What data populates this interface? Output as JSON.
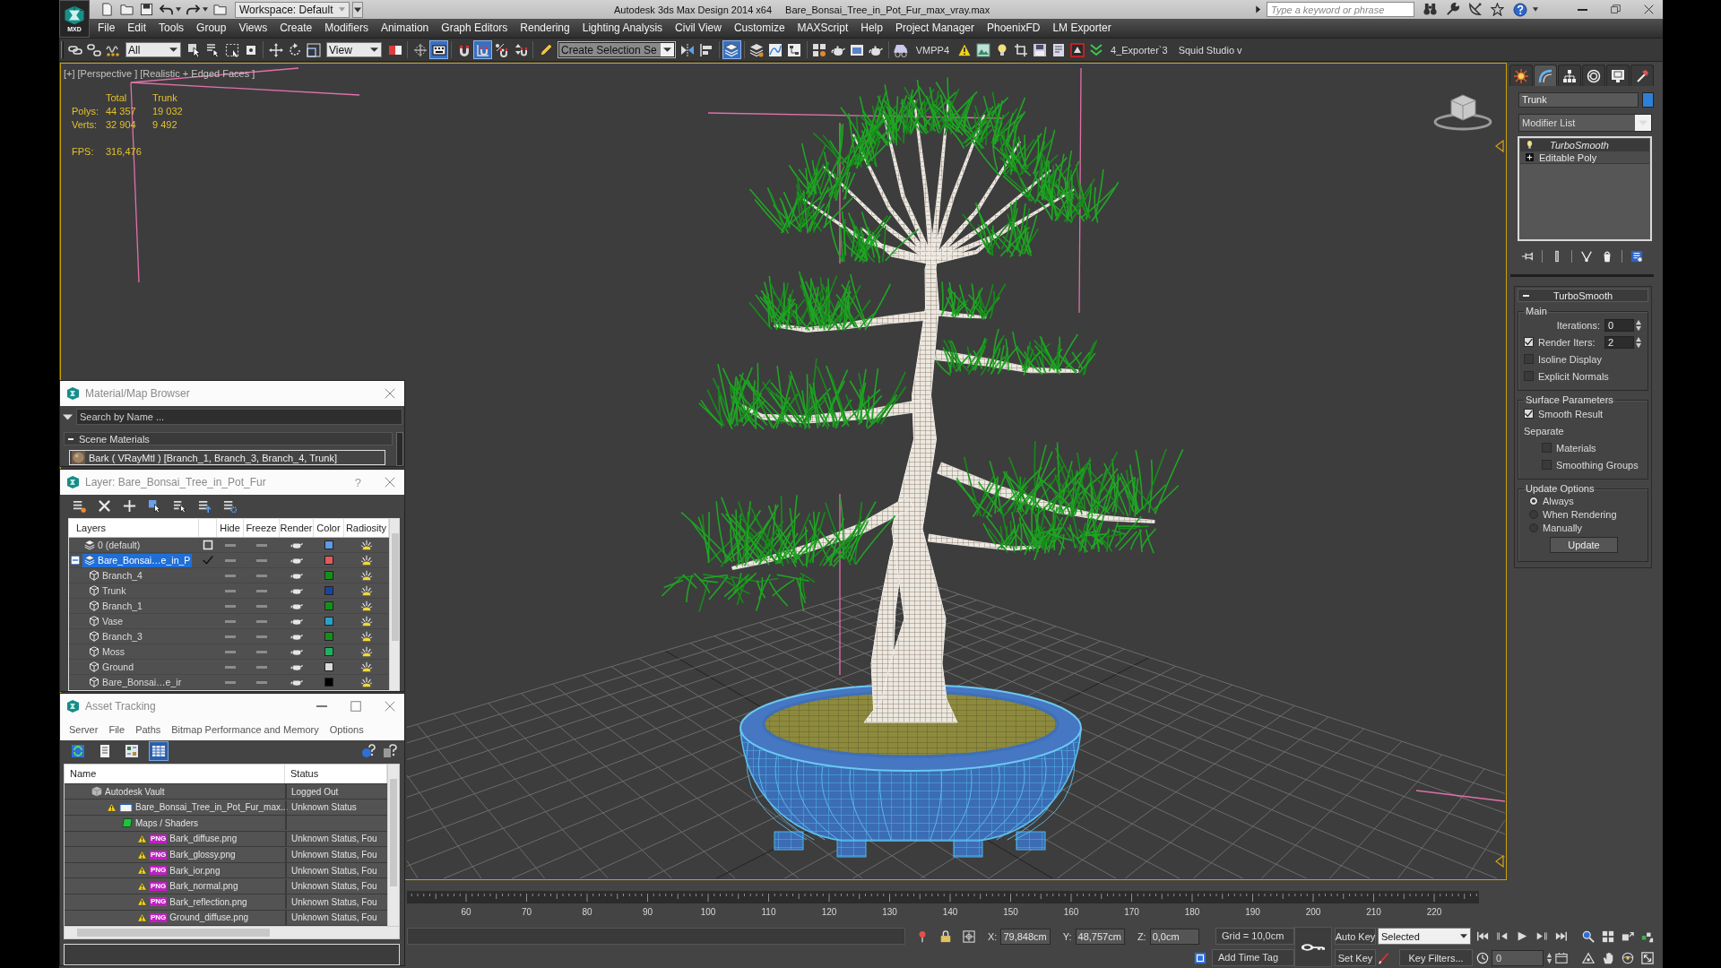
{
  "title_bar": {
    "logo_label": "MXD",
    "workspace": "Workspace: Default",
    "app_name": "Autodesk 3ds Max Design 2014 x64",
    "file_name": "Bare_Bonsai_Tree_in_Pot_Fur_max_vray.max",
    "search": {
      "placeholder": "Type a keyword or phrase"
    }
  },
  "menu": [
    "File",
    "Edit",
    "Tools",
    "Group",
    "Views",
    "Create",
    "Modifiers",
    "Animation",
    "Graph Editors",
    "Rendering",
    "Lighting Analysis",
    "Civil View",
    "Customize",
    "MAXScript",
    "Help",
    "Project Manager",
    "PhoenixFD",
    "LM Exporter"
  ],
  "toolbar": [
    {
      "kind": "button",
      "on": false
    },
    {
      "kind": "button",
      "on": false
    },
    {
      "kind": "button",
      "on": false
    },
    {
      "kind": "dropdown",
      "value": "All"
    },
    {
      "kind": "button",
      "on": false
    },
    {
      "kind": "button",
      "on": false
    },
    {
      "kind": "button",
      "on": false
    },
    {
      "kind": "button",
      "on": false
    },
    {
      "kind": "separator"
    },
    {
      "kind": "button",
      "on": false
    },
    {
      "kind": "button",
      "on": false
    },
    {
      "kind": "button",
      "on": false
    },
    {
      "kind": "dropdown",
      "value": "View"
    },
    {
      "kind": "button",
      "on": false
    },
    {
      "kind": "separator"
    },
    {
      "kind": "button",
      "on": false
    },
    {
      "kind": "button",
      "on": true
    },
    {
      "kind": "separator"
    },
    {
      "kind": "button",
      "on": false
    },
    {
      "kind": "button",
      "on": true
    },
    {
      "kind": "button",
      "on": false
    },
    {
      "kind": "button",
      "on": false
    },
    {
      "kind": "separator"
    },
    {
      "kind": "button",
      "on": false
    },
    {
      "kind": "combo",
      "value": "Create Selection Se"
    },
    {
      "kind": "button",
      "on": false
    },
    {
      "kind": "button",
      "on": false
    },
    {
      "kind": "separator"
    },
    {
      "kind": "button",
      "on": true
    },
    {
      "kind": "separator"
    },
    {
      "kind": "button",
      "on": false
    },
    {
      "kind": "button",
      "on": false
    },
    {
      "kind": "button",
      "on": false
    },
    {
      "kind": "separator"
    },
    {
      "kind": "button",
      "on": false
    },
    {
      "kind": "button",
      "on": false
    },
    {
      "kind": "button",
      "on": false
    },
    {
      "kind": "button",
      "on": false
    },
    {
      "kind": "separator"
    },
    {
      "kind": "button",
      "on": false
    },
    {
      "kind": "label",
      "text": "VMPP4"
    },
    {
      "kind": "button",
      "on": false
    },
    {
      "kind": "button",
      "on": false
    },
    {
      "kind": "button",
      "on": false
    },
    {
      "kind": "button",
      "on": false
    },
    {
      "kind": "button",
      "on": false
    },
    {
      "kind": "button",
      "on": false
    },
    {
      "kind": "button",
      "on": false
    },
    {
      "kind": "button",
      "on": false
    },
    {
      "kind": "label",
      "text": "4_Exporter`3"
    },
    {
      "kind": "label",
      "text": "Squid Studio v"
    }
  ],
  "viewport": {
    "labels": [
      "[+]",
      "[Perspective ]",
      "[Realistic + Edged Faces ]"
    ],
    "stats": {
      "columns": [
        "Total",
        "Trunk"
      ],
      "rows": [
        {
          "label": "Polys:",
          "values": [
            "44 357",
            "19 032"
          ]
        },
        {
          "label": "Verts:",
          "values": [
            "32 904",
            "9 492"
          ]
        }
      ],
      "fps": {
        "label": "FPS:",
        "value": "316,476"
      }
    }
  },
  "material_browser": {
    "title": "Material/Map Browser",
    "search": {
      "placeholder": "Search by Name ..."
    },
    "group": {
      "label": "Scene Materials",
      "expanded": true
    },
    "items": [
      "Bark ( VRayMtl ) [Branch_1, Branch_3, Branch_4, Trunk]"
    ]
  },
  "layer_dialog": {
    "title": "Layer: Bare_Bonsai_Tree_in_Pot_Fur",
    "help": "?",
    "columns": [
      "Layers",
      "Hide",
      "Freeze",
      "Render",
      "Color",
      "Radiosity"
    ],
    "layers": [
      {
        "name": "0 (default)",
        "selected": false,
        "current": false,
        "hidden": false,
        "frozen": false,
        "renderable": true,
        "radiosity": true,
        "color": "#5b9be8"
      },
      {
        "name": "Bare_Bonsai…e_in_P",
        "selected": true,
        "current": true,
        "expanded": true,
        "hidden": false,
        "frozen": false,
        "renderable": true,
        "radiosity": true,
        "color": "#e25a5a",
        "children": [
          {
            "name": "Branch_4",
            "selected": false,
            "hidden": false,
            "frozen": false,
            "renderable": true,
            "radiosity": true,
            "color": "#14901a"
          },
          {
            "name": "Trunk",
            "selected": false,
            "hidden": false,
            "frozen": false,
            "renderable": true,
            "radiosity": true,
            "color": "#1a43a0"
          },
          {
            "name": "Branch_1",
            "selected": false,
            "hidden": false,
            "frozen": false,
            "renderable": true,
            "radiosity": true,
            "color": "#14901a"
          },
          {
            "name": "Vase",
            "selected": false,
            "hidden": false,
            "frozen": false,
            "renderable": true,
            "radiosity": true,
            "color": "#2aa0c8"
          },
          {
            "name": "Branch_3",
            "selected": false,
            "hidden": false,
            "frozen": false,
            "renderable": true,
            "radiosity": true,
            "color": "#14901a"
          },
          {
            "name": "Moss",
            "selected": false,
            "hidden": false,
            "frozen": false,
            "renderable": true,
            "radiosity": true,
            "color": "#20b060"
          },
          {
            "name": "Ground",
            "selected": false,
            "hidden": false,
            "frozen": false,
            "renderable": true,
            "radiosity": true,
            "color": "#dcdcdc"
          },
          {
            "name": "Bare_Bonsai…e_ir",
            "selected": false,
            "hidden": false,
            "frozen": false,
            "renderable": true,
            "radiosity": true,
            "color": "#000000"
          }
        ]
      }
    ]
  },
  "asset_tracking": {
    "title": "Asset Tracking",
    "menu": [
      "Server",
      "File",
      "Paths",
      "Bitmap Performance and Memory",
      "Options"
    ],
    "toolbar": [
      {
        "on": false
      },
      {
        "on": false
      },
      {
        "on": false
      },
      {
        "on": true
      }
    ],
    "columns": [
      "Name",
      "Status"
    ],
    "tree": [
      {
        "kind": "vault",
        "name": "Autodesk Vault",
        "status": "Logged Out",
        "children": [
          {
            "kind": "scene",
            "name": "Bare_Bonsai_Tree_in_Pot_Fur_max...",
            "status": "Unknown Status",
            "warning": true,
            "children": [
              {
                "kind": "folder",
                "name": "Maps / Shaders",
                "children": [
                  {
                    "kind": "image",
                    "badge": "PNG",
                    "name": "Bark_diffuse.png",
                    "status": "Unknown Status, Fou",
                    "warning": true
                  },
                  {
                    "kind": "image",
                    "badge": "PNG",
                    "name": "Bark_glossy.png",
                    "status": "Unknown Status, Fou",
                    "warning": true
                  },
                  {
                    "kind": "image",
                    "badge": "PNG",
                    "name": "Bark_ior.png",
                    "status": "Unknown Status, Fou",
                    "warning": true
                  },
                  {
                    "kind": "image",
                    "badge": "PNG",
                    "name": "Bark_normal.png",
                    "status": "Unknown Status, Fou",
                    "warning": true
                  },
                  {
                    "kind": "image",
                    "badge": "PNG",
                    "name": "Bark_reflection.png",
                    "status": "Unknown Status, Fou",
                    "warning": true
                  },
                  {
                    "kind": "image",
                    "badge": "PNG",
                    "name": "Ground_diffuse.png",
                    "status": "Unknown Status, Fou",
                    "warning": true
                  }
                ]
              }
            ]
          }
        ]
      }
    ]
  },
  "command_panel": {
    "tabs": [
      {
        "selected": false
      },
      {
        "selected": true
      },
      {
        "selected": false
      },
      {
        "selected": false
      },
      {
        "selected": false
      },
      {
        "selected": false
      }
    ],
    "object": {
      "name": "Trunk",
      "color": "#2f80d6"
    },
    "modifier_list": "Modifier List",
    "stack": [
      {
        "kind": "modifier",
        "name": "TurboSmooth",
        "selected": true,
        "enabled": true
      },
      {
        "kind": "base",
        "name": "Editable Poly",
        "selected": false,
        "expanded": false
      }
    ],
    "rollout": {
      "title": "TurboSmooth",
      "expanded": true,
      "groups": [
        {
          "title": "Main",
          "controls": [
            {
              "kind": "spinner",
              "label": "Iterations:",
              "value": "0"
            },
            {
              "kind": "check_spinner",
              "label": "Render Iters:",
              "checked": true,
              "value": "2"
            },
            {
              "kind": "checkbox",
              "label": "Isoline Display",
              "checked": false
            },
            {
              "kind": "checkbox",
              "label": "Explicit Normals",
              "checked": false
            }
          ]
        },
        {
          "title": "Surface Parameters",
          "controls": [
            {
              "kind": "checkbox",
              "label": "Smooth Result",
              "checked": true
            },
            {
              "kind": "label",
              "text": "Separate",
              "children": [
                {
                  "kind": "checkbox",
                  "label": "Materials",
                  "checked": false
                },
                {
                  "kind": "checkbox",
                  "label": "Smoothing Groups",
                  "checked": false
                }
              ]
            }
          ]
        },
        {
          "title": "Update Options",
          "controls": [
            {
              "kind": "radio",
              "label": "Always",
              "selected": true
            },
            {
              "kind": "radio",
              "label": "When Rendering",
              "selected": false
            },
            {
              "kind": "radio",
              "label": "Manually",
              "selected": false
            },
            {
              "kind": "button",
              "label": "Update"
            }
          ]
        }
      ]
    }
  },
  "timeline": {
    "frames": [
      "60",
      "70",
      "80",
      "90",
      "100",
      "110",
      "120",
      "130",
      "140",
      "150",
      "160",
      "170",
      "180",
      "190",
      "200",
      "210",
      "220"
    ]
  },
  "status_bar": {
    "coords": [
      {
        "axis": "X:",
        "value": "79,848cm"
      },
      {
        "axis": "Y:",
        "value": "48,757cm"
      },
      {
        "axis": "Z:",
        "value": "0,0cm"
      }
    ],
    "grid": "Grid = 10,0cm",
    "time_tag": "Add Time Tag",
    "auto_key": {
      "label": "Auto Key",
      "on": false
    },
    "key_mode": "Selected",
    "set_key": "Set Key",
    "key_filters": "Key Filters...",
    "frame": "0"
  }
}
